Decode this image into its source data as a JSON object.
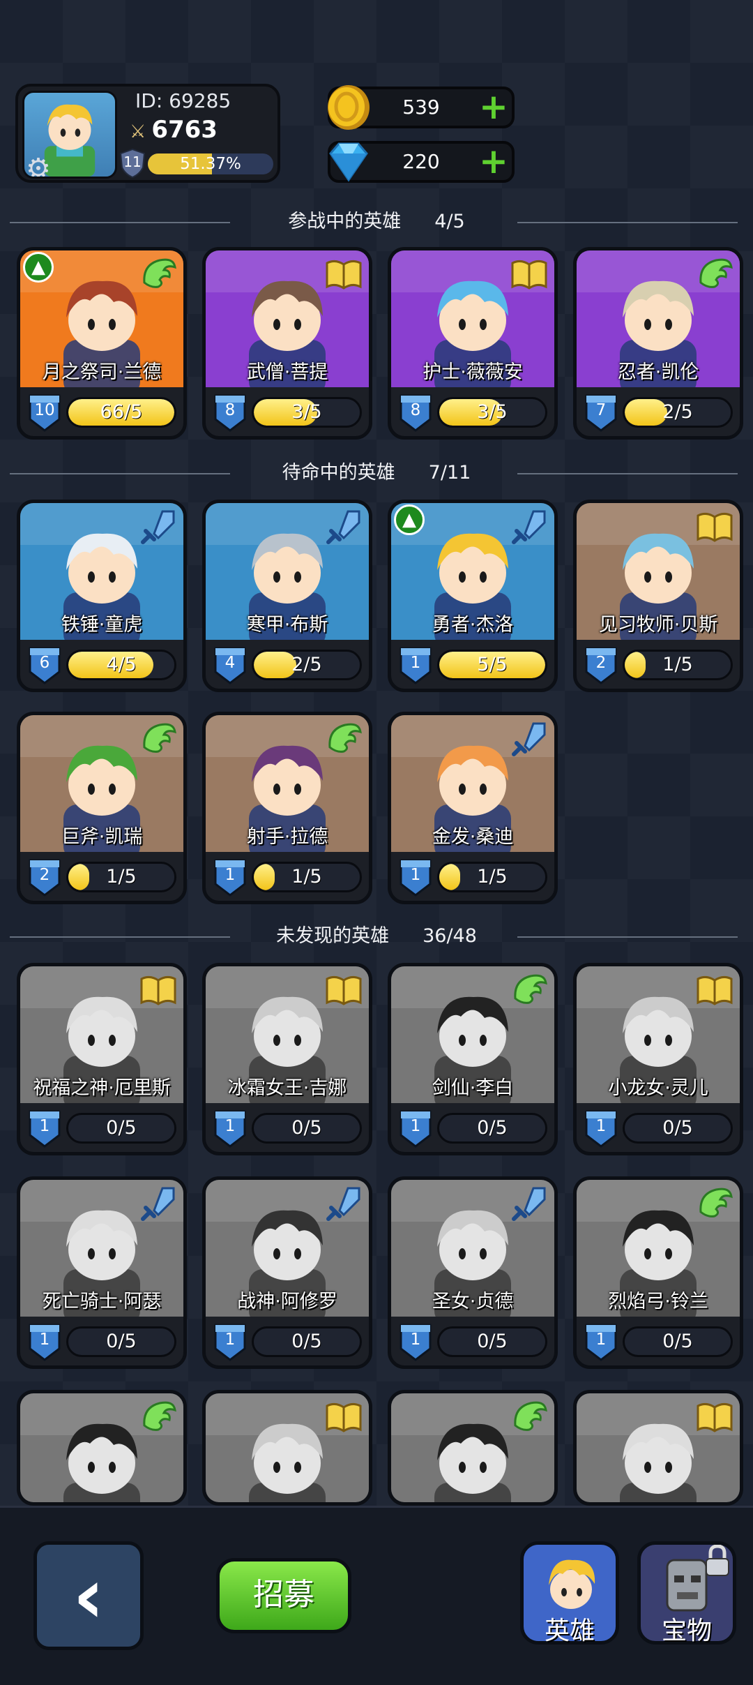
{
  "player": {
    "id_text": "ID: 69285",
    "power": "6763",
    "level": "11",
    "xp_percent_text": "51.37%",
    "xp_fraction": 0.5137
  },
  "currency": {
    "gold": "539",
    "gems": "220"
  },
  "sections": {
    "battle": {
      "title": "参战中的英雄",
      "count": "4/5"
    },
    "standby": {
      "title": "待命中的英雄",
      "count": "7/11"
    },
    "undiscovered": {
      "title": "未发现的英雄",
      "count": "36/48"
    }
  },
  "battle_heroes": [
    {
      "name": "月之祭司·兰德",
      "level": "10",
      "progress": "66/5",
      "fill": 1.0,
      "class_icon": "wing-icon",
      "upgrade": true,
      "bg": "#f07a1e",
      "hair": "#a8432a"
    },
    {
      "name": "武僧·菩提",
      "level": "8",
      "progress": "3/5",
      "fill": 0.6,
      "class_icon": "book-icon",
      "upgrade": false,
      "bg": "#8a3fd0",
      "hair": "#7a5a48"
    },
    {
      "name": "护士·薇薇安",
      "level": "8",
      "progress": "3/5",
      "fill": 0.6,
      "class_icon": "book-icon",
      "upgrade": false,
      "bg": "#8a3fd0",
      "hair": "#5ab8ea"
    },
    {
      "name": "忍者·凯伦",
      "level": "7",
      "progress": "2/5",
      "fill": 0.4,
      "class_icon": "wing-icon",
      "upgrade": false,
      "bg": "#8a3fd0",
      "hair": "#d8cfb0"
    }
  ],
  "standby_heroes": [
    {
      "name": "铁锤·童虎",
      "level": "6",
      "progress": "4/5",
      "fill": 0.8,
      "class_icon": "sword-icon",
      "upgrade": false,
      "bg": "#3a8fc8",
      "hair": "#e8eef4"
    },
    {
      "name": "寒甲·布斯",
      "level": "4",
      "progress": "2/5",
      "fill": 0.4,
      "class_icon": "sword-icon",
      "upgrade": false,
      "bg": "#3a8fc8",
      "hair": "#b8c2cc"
    },
    {
      "name": "勇者·杰洛",
      "level": "1",
      "progress": "5/5",
      "fill": 1.0,
      "class_icon": "sword-icon",
      "upgrade": true,
      "bg": "#3a8fc8",
      "hair": "#f4c533"
    },
    {
      "name": "见习牧师·贝斯",
      "level": "2",
      "progress": "1/5",
      "fill": 0.2,
      "class_icon": "book-icon",
      "upgrade": false,
      "bg": "#9a7a62",
      "hair": "#7ac0e0"
    },
    {
      "name": "巨斧·凯瑞",
      "level": "2",
      "progress": "1/5",
      "fill": 0.2,
      "class_icon": "wing-icon",
      "upgrade": false,
      "bg": "#9a7a62",
      "hair": "#4aa83a"
    },
    {
      "name": "射手·拉德",
      "level": "1",
      "progress": "1/5",
      "fill": 0.2,
      "class_icon": "wing-icon",
      "upgrade": false,
      "bg": "#9a7a62",
      "hair": "#6a3a7a"
    },
    {
      "name": "金发·桑迪",
      "level": "1",
      "progress": "1/5",
      "fill": 0.2,
      "class_icon": "sword-icon",
      "upgrade": false,
      "bg": "#9a7a62",
      "hair": "#f29a4a"
    }
  ],
  "undiscovered_heroes": [
    {
      "name": "祝福之神·厄里斯",
      "level": "1",
      "progress": "0/5",
      "fill": 0,
      "class_icon": "book-icon",
      "upgrade": false,
      "bg": "#777777",
      "hair": "#dddddd"
    },
    {
      "name": "冰霜女王·吉娜",
      "level": "1",
      "progress": "0/5",
      "fill": 0,
      "class_icon": "book-icon",
      "upgrade": false,
      "bg": "#777777",
      "hair": "#cccccc"
    },
    {
      "name": "剑仙·李白",
      "level": "1",
      "progress": "0/5",
      "fill": 0,
      "class_icon": "wing-icon",
      "upgrade": false,
      "bg": "#777777",
      "hair": "#222222"
    },
    {
      "name": "小龙女·灵儿",
      "level": "1",
      "progress": "0/5",
      "fill": 0,
      "class_icon": "book-icon",
      "upgrade": false,
      "bg": "#777777",
      "hair": "#cccccc"
    },
    {
      "name": "死亡骑士·阿瑟",
      "level": "1",
      "progress": "0/5",
      "fill": 0,
      "class_icon": "sword-icon",
      "upgrade": false,
      "bg": "#777777",
      "hair": "#dddddd"
    },
    {
      "name": "战神·阿修罗",
      "level": "1",
      "progress": "0/5",
      "fill": 0,
      "class_icon": "sword-icon",
      "upgrade": false,
      "bg": "#777777",
      "hair": "#333333"
    },
    {
      "name": "圣女·贞德",
      "level": "1",
      "progress": "0/5",
      "fill": 0,
      "class_icon": "sword-icon",
      "upgrade": false,
      "bg": "#777777",
      "hair": "#cccccc"
    },
    {
      "name": "烈焰弓·铃兰",
      "level": "1",
      "progress": "0/5",
      "fill": 0,
      "class_icon": "wing-icon",
      "upgrade": false,
      "bg": "#777777",
      "hair": "#222222"
    },
    {
      "name": "",
      "level": "",
      "progress": "",
      "fill": 0,
      "class_icon": "wing-icon",
      "upgrade": false,
      "bg": "#777777",
      "hair": "#222222"
    },
    {
      "name": "",
      "level": "",
      "progress": "",
      "fill": 0,
      "class_icon": "book-icon",
      "upgrade": false,
      "bg": "#777777",
      "hair": "#cccccc"
    },
    {
      "name": "",
      "level": "",
      "progress": "",
      "fill": 0,
      "class_icon": "wing-icon",
      "upgrade": false,
      "bg": "#777777",
      "hair": "#222222"
    },
    {
      "name": "",
      "level": "",
      "progress": "",
      "fill": 0,
      "class_icon": "book-icon",
      "upgrade": false,
      "bg": "#777777",
      "hair": "#dddddd"
    }
  ],
  "bottom_nav": {
    "recruit_label": "招募",
    "heroes_label": "英雄",
    "treasure_label": "宝物"
  },
  "colors": {
    "gold": "#f4c31f",
    "gem": "#3ab0f0",
    "plus": "#5fd130",
    "heroes_tab": "#3f66c8",
    "treasure_tab": "#3a3f70"
  }
}
